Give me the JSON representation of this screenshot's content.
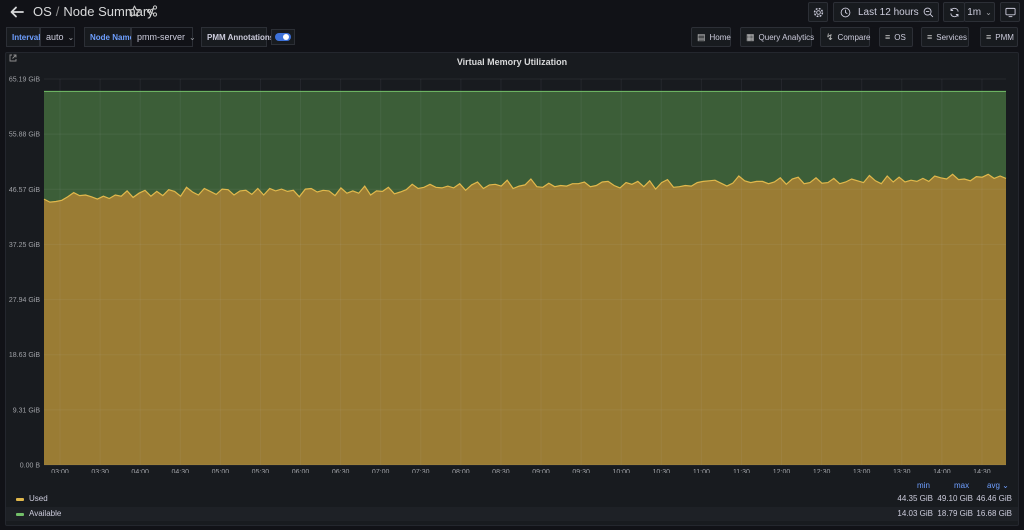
{
  "breadcrumb": {
    "folder": "OS",
    "separator": "/",
    "dashboard": "Node Summary"
  },
  "toolbar": {
    "time_range": "Last 12 hours",
    "refresh_interval": "1m"
  },
  "variables": {
    "interval": {
      "label": "Interval",
      "value": "auto"
    },
    "node_name": {
      "label": "Node Name",
      "value": "pmm-server"
    },
    "annotations": {
      "label": "PMM Annotations",
      "enabled": true
    }
  },
  "links": [
    {
      "label": "Home",
      "icon": "document-icon"
    },
    {
      "label": "Query Analytics",
      "icon": "grid-icon"
    },
    {
      "label": "Compare",
      "icon": "bolt-icon"
    },
    {
      "label": "OS",
      "icon": "menu-icon"
    },
    {
      "label": "Services",
      "icon": "menu-icon"
    },
    {
      "label": "PMM",
      "icon": "menu-icon"
    }
  ],
  "panel": {
    "title": "Virtual Memory Utilization"
  },
  "colors": {
    "used": "#9a7c34",
    "used_line": "#e0b84c",
    "available": "#3c5e38",
    "available_line": "#73bf69",
    "accent": "#6e9fff"
  },
  "chart_data": {
    "type": "area",
    "stacked": true,
    "y_tick_labels": [
      "0.00 B",
      "9.31 GiB",
      "18.63 GiB",
      "27.94 GiB",
      "37.25 GiB",
      "46.57 GiB",
      "55.88 GiB",
      "65.19 GiB"
    ],
    "ylim": [
      0,
      65.19
    ],
    "y_unit": "GiB",
    "x_tick_labels": [
      "03:00",
      "03:30",
      "04:00",
      "04:30",
      "05:00",
      "05:30",
      "06:00",
      "06:30",
      "07:00",
      "07:30",
      "08:00",
      "08:30",
      "09:00",
      "09:30",
      "10:00",
      "10:30",
      "11:00",
      "11:30",
      "12:00",
      "12:30",
      "13:00",
      "13:30",
      "14:00",
      "14:30"
    ],
    "x_range": [
      "02:48",
      "14:48"
    ],
    "total": 63.1,
    "series": [
      {
        "name": "Used",
        "values": [
          44.9,
          44.4,
          44.5,
          44.7,
          45.3,
          46.0,
          45.5,
          45.6,
          45.3,
          44.9,
          45.4,
          45.0,
          45.6,
          45.4,
          46.3,
          45.2,
          45.9,
          46.4,
          45.4,
          46.2,
          45.5,
          46.5,
          46.2,
          45.4,
          46.9,
          46.1,
          45.6,
          46.7,
          46.2,
          45.7,
          46.6,
          46.5,
          45.6,
          46.3,
          46.4,
          45.7,
          46.7,
          45.6,
          46.7,
          46.3,
          46.6,
          46.2,
          46.4,
          45.3,
          46.6,
          46.7,
          46.1,
          46.4,
          46.3,
          45.5,
          46.8,
          45.9,
          46.3,
          45.9,
          47.1,
          45.6,
          46.3,
          46.2,
          46.9,
          45.8,
          46.1,
          46.5,
          47.4,
          46.7,
          46.9,
          47.4,
          46.9,
          46.8,
          47.1,
          46.8,
          47.5,
          46.4,
          47.3,
          47.8,
          46.7,
          47.3,
          47.4,
          47.1,
          48.1,
          46.7,
          47.1,
          47.3,
          48.3,
          47.0,
          46.9,
          47.6,
          47.0,
          47.2,
          47.1,
          47.5,
          47.5,
          47.8,
          47.0,
          47.2,
          47.8,
          47.9,
          47.2,
          46.8,
          47.7,
          47.4,
          47.9,
          47.0,
          48.0,
          46.6,
          47.7,
          48.2,
          46.9,
          47.0,
          47.2,
          47.1,
          47.7,
          47.9,
          48.0,
          48.1,
          47.6,
          47.1,
          47.6,
          48.8,
          48.0,
          47.7,
          47.9,
          47.9,
          47.5,
          47.8,
          48.5,
          47.4,
          48.3,
          48.6,
          47.5,
          47.7,
          48.5,
          47.6,
          47.7,
          48.4,
          47.5,
          47.8,
          48.3,
          48.0,
          47.7,
          48.9,
          48.0,
          47.5,
          48.8,
          47.8,
          48.6,
          47.8,
          48.1,
          47.9,
          48.4,
          47.9,
          48.8,
          48.5,
          48.3,
          49.1,
          48.2,
          48.3,
          48.0,
          48.7,
          48.6,
          49.1,
          48.4,
          48.8,
          48.4
        ]
      },
      {
        "name": "Available"
      }
    ]
  },
  "legend": {
    "headers": {
      "min": "min",
      "max": "max",
      "avg": "avg"
    },
    "rows": [
      {
        "name": "Used",
        "min": "44.35 GiB",
        "max": "49.10 GiB",
        "avg": "46.46 GiB"
      },
      {
        "name": "Available",
        "min": "14.03 GiB",
        "max": "18.79 GiB",
        "avg": "16.68 GiB"
      }
    ]
  }
}
